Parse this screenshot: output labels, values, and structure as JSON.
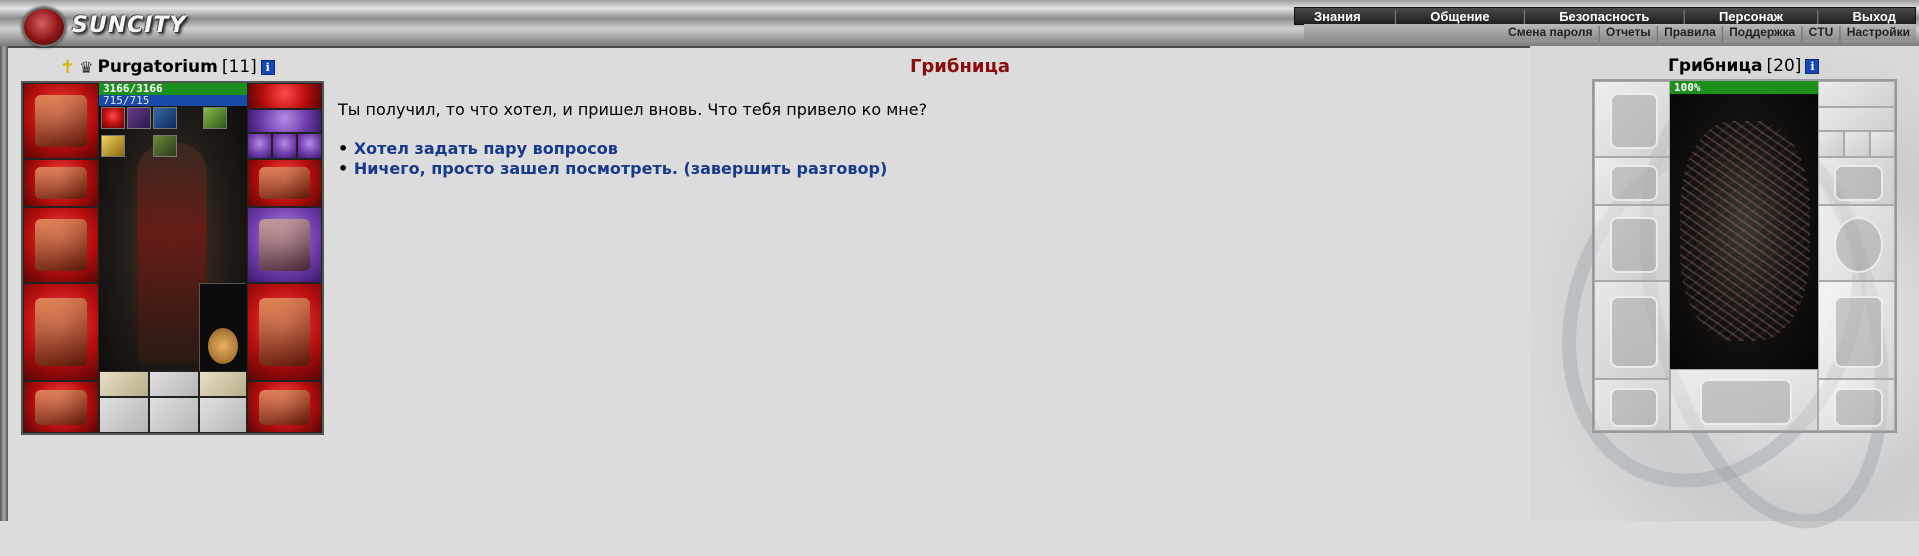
{
  "app": {
    "logo_text": "SUNCITY"
  },
  "menu": {
    "primary": [
      "Знания",
      "Общение",
      "Безопасность",
      "Персонаж",
      "Выход"
    ],
    "secondary": [
      "Смена пароля",
      "Отчеты",
      "Правила",
      "Поддержка",
      "CTU",
      "Настройки"
    ]
  },
  "player": {
    "name": "Purgatorium",
    "level": "[11]",
    "hp": "3166/3166",
    "mp": "715/715",
    "info_glyph": "i"
  },
  "dialog": {
    "title": "Грибница",
    "speech": "Ты получил, то что хотел, и пришел вновь. Что тебя привело ко мне?",
    "bullet": "•",
    "options": [
      "Хотел задать пару вопросов",
      "Ничего, просто зашел посмотреть. (завершить разговор)"
    ]
  },
  "npc": {
    "name": "Грибница",
    "level": "[20]",
    "hp": "100%",
    "info_glyph": "i"
  },
  "icons": {
    "cross": "✝",
    "clan": "♛"
  },
  "colors": {
    "title_red": "#8a0c0c",
    "link_blue": "#173a8a",
    "hp_green": "#1c8f1c",
    "mp_blue": "#1a4aa8"
  }
}
